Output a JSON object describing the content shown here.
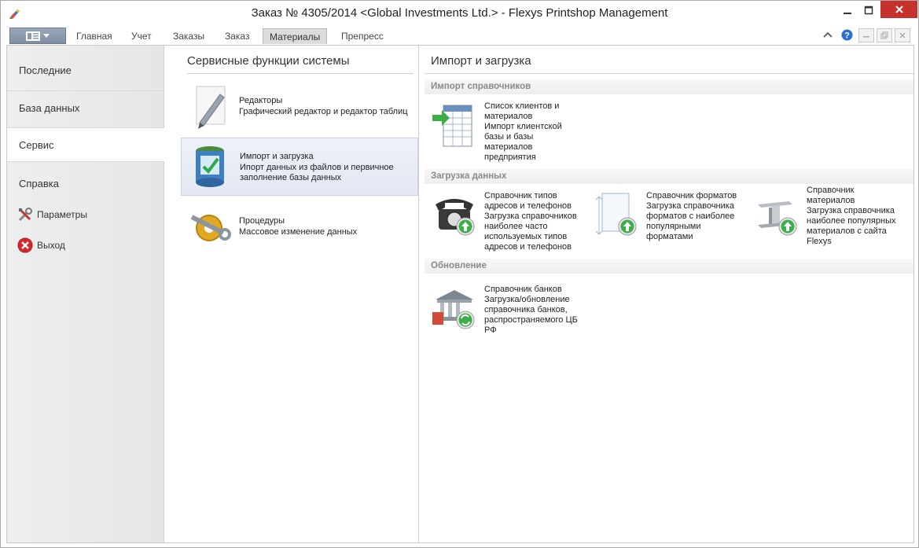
{
  "window": {
    "title": "Заказ № 4305/2014 <Global Investments Ltd.> - Flexys Printshop Management"
  },
  "ribbon": {
    "tabs": [
      "Главная",
      "Учет",
      "Заказы",
      "Заказ",
      "Материалы",
      "Препресс"
    ],
    "active_tab": "Материалы"
  },
  "leftnav": {
    "items": [
      "Последние",
      "База данных",
      "Сервис",
      "Справка"
    ],
    "selected": "Сервис",
    "params_label": "Параметры",
    "exit_label": "Выход"
  },
  "services": {
    "title": "Сервисные функции системы",
    "items": [
      {
        "name": "Редакторы",
        "desc": "Графический редактор и редактор таблиц"
      },
      {
        "name": "Импорт и загрузка",
        "desc_line1": "Ипорт данных из файлов и первичное",
        "desc_line2": "заполнение базы данных"
      },
      {
        "name": "Процедуры",
        "desc": "Массовое изменение данных"
      }
    ]
  },
  "import": {
    "title": "Импорт и загрузка",
    "sections": {
      "s1": "Импорт справочников",
      "s2": "Загрузка данных",
      "s3": "Обновление"
    },
    "clients": {
      "t1": "Список клиентов и",
      "t2": "материалов",
      "d1": "Импорт клиентской",
      "d2": "базы и базы",
      "d3": "материалов",
      "d4": "предприятия"
    },
    "phones": {
      "t1": "Справочник типов",
      "t2": "адресов и телефонов",
      "d1": "Загрузка справочников",
      "d2": "наиболее часто",
      "d3": "используемых типов",
      "d4": "адресов и телефонов"
    },
    "formats": {
      "t1": "Справочник форматов",
      "d1": "Загрузка справочника",
      "d2": "форматов с наиболее",
      "d3": "популярными",
      "d4": "форматами"
    },
    "materials": {
      "t1": "Справочник",
      "t2": "материалов",
      "d1": "Загрузка справочника",
      "d2": "наиболее популярных",
      "d3": "материалов с сайта",
      "d4": "Flexys"
    },
    "banks": {
      "t1": "Справочник банков",
      "d1": "Загрузка/обновление",
      "d2": "справочника банков,",
      "d3": "распространяемого ЦБ",
      "d4": "РФ"
    }
  },
  "colors": {
    "close_button": "#c7312b",
    "selection_bg": "#e3e8f3",
    "section_header_text": "#8a8a8a"
  }
}
